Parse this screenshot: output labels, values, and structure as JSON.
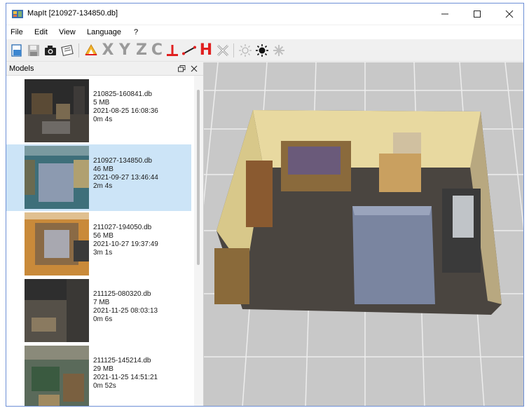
{
  "window": {
    "title": "MapIt [210927-134850.db]"
  },
  "menu": [
    "File",
    "Edit",
    "View",
    "Language",
    "?"
  ],
  "toolbar": {
    "letters": [
      "X",
      "Y",
      "Z",
      "C"
    ],
    "height_letter": "H"
  },
  "panel": {
    "title": "Models",
    "float_glyph": "ᴿ",
    "close_glyph": "✕"
  },
  "models": [
    {
      "name": "210825-160841.db",
      "size": "5 MB",
      "date": "2021-08-25 16:08:36",
      "duration": "0m 4s",
      "selected": false
    },
    {
      "name": "210927-134850.db",
      "size": "46 MB",
      "date": "2021-09-27 13:46:44",
      "duration": "2m 4s",
      "selected": true
    },
    {
      "name": "211027-194050.db",
      "size": "56 MB",
      "date": "2021-10-27 19:37:49",
      "duration": "3m 1s",
      "selected": false
    },
    {
      "name": "211125-080320.db",
      "size": "7 MB",
      "date": "2021-11-25 08:03:13",
      "duration": "0m 6s",
      "selected": false
    },
    {
      "name": "211125-145214.db",
      "size": "29 MB",
      "date": "2021-11-25 14:51:21",
      "duration": "0m 52s",
      "selected": false
    }
  ],
  "colors": {
    "accent": "#cce4f7",
    "axis_red": "#e02020",
    "floor": "#c9c9c9"
  }
}
